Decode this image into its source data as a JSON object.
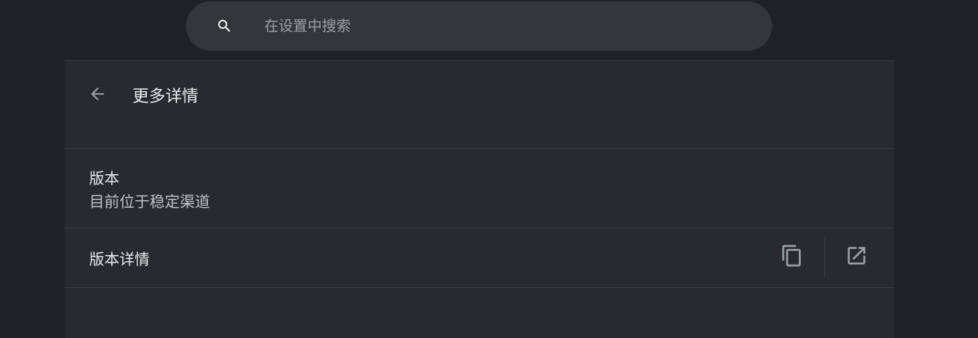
{
  "search": {
    "placeholder": "在设置中搜索",
    "icon": "search-icon"
  },
  "header": {
    "back_icon": "arrow-back-icon",
    "title": "更多详情"
  },
  "rows": {
    "version": {
      "label": "版本",
      "sublabel": "目前位于稳定渠道"
    },
    "version_details": {
      "label": "版本详情",
      "copy_icon": "copy-icon",
      "open_icon": "open-in-new-icon"
    }
  },
  "colors": {
    "background": "#202124",
    "card": "#292a2d",
    "search_field": "#35363a",
    "icon": "#9aa0a6",
    "text_primary": "#e8eaed",
    "text_secondary": "#bdc1c6"
  }
}
